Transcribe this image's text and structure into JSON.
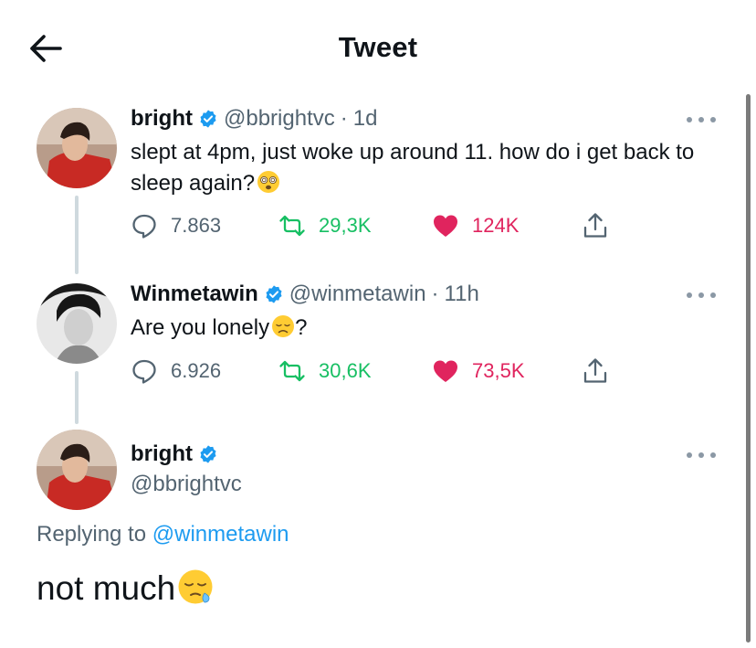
{
  "header": {
    "title": "Tweet",
    "back_icon": "arrow-left-icon"
  },
  "colors": {
    "blue": "#1d9bf0",
    "green": "#17bf63",
    "pink": "#e0245e",
    "gray": "#536471"
  },
  "tweets": [
    {
      "name": "bright",
      "handle": "@bbrightvc",
      "dot": "·",
      "time": "1d",
      "text": "slept at 4pm, just woke up around 11. how do i get back to sleep again?",
      "emoji": "face-with-spiral-eyes",
      "replies": "7.863",
      "retweets": "29,3K",
      "likes": "124K"
    },
    {
      "name": "Winmetawin",
      "handle": "@winmetawin",
      "dot": "·",
      "time": "11h",
      "text": "Are you lonely",
      "text_suffix": "?",
      "emoji": "disappointed-face",
      "replies": "6.926",
      "retweets": "30,6K",
      "likes": "73,5K"
    }
  ],
  "main_tweet": {
    "name": "bright",
    "handle": "@bbrightvc",
    "replying_prefix": "Replying to",
    "replying_to": "@winmetawin",
    "text": "not much",
    "emoji": "sleepy-face"
  }
}
